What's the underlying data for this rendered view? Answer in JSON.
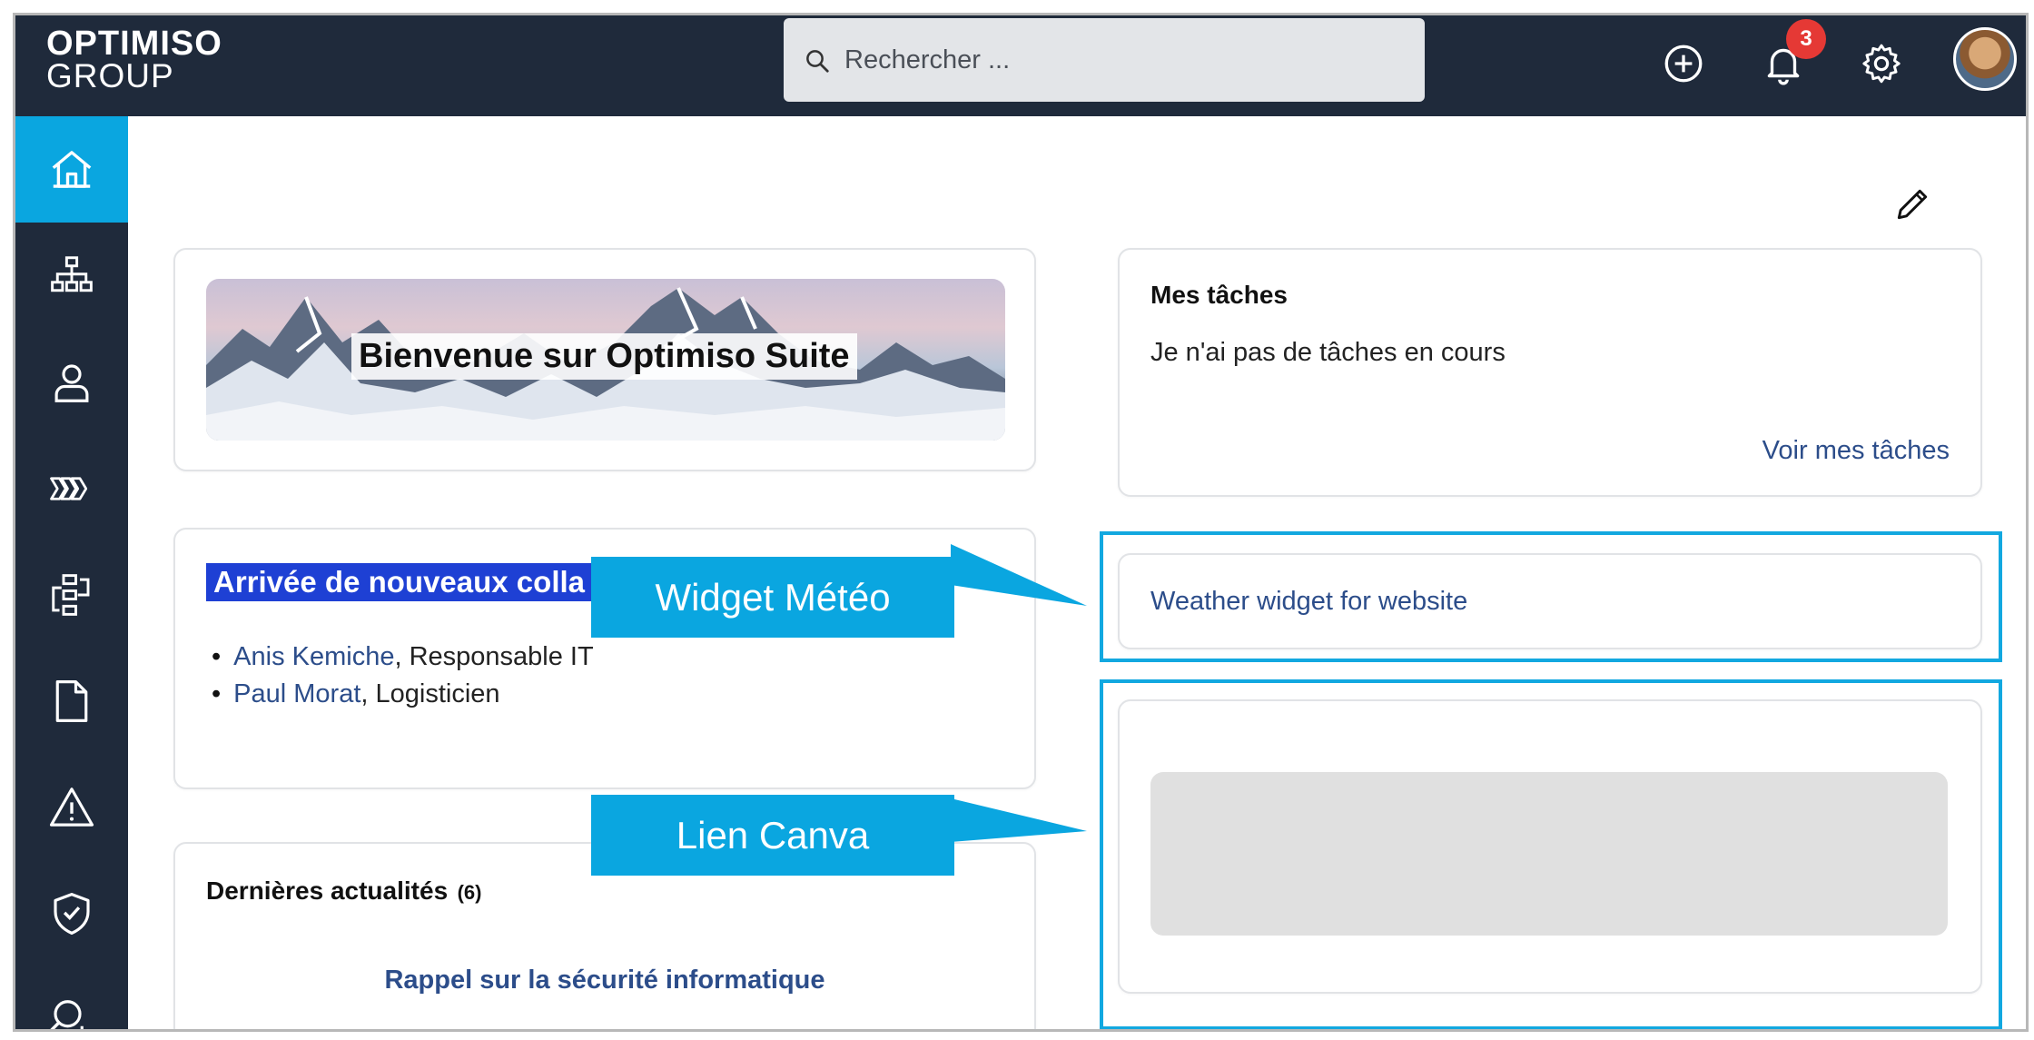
{
  "header": {
    "logo_line1": "OPTIMISO",
    "logo_line2": "GROUP",
    "search_placeholder": "Rechercher ...",
    "notification_count": "3",
    "icons": [
      "search-icon",
      "add-circle-icon",
      "bell-icon",
      "gear-icon",
      "avatar"
    ]
  },
  "sidebar": {
    "items": [
      {
        "icon": "home-icon",
        "active": true
      },
      {
        "icon": "org-chart-icon"
      },
      {
        "icon": "user-icon"
      },
      {
        "icon": "process-chevrons-icon"
      },
      {
        "icon": "workflow-icon"
      },
      {
        "icon": "document-icon"
      },
      {
        "icon": "warning-icon"
      },
      {
        "icon": "shield-check-icon"
      },
      {
        "icon": "search-analytics-icon"
      }
    ]
  },
  "welcome_card": {
    "banner_title": "Bienvenue sur Optimiso Suite"
  },
  "newcomers_card": {
    "title": "Arrivée de nouveaux colla",
    "people": [
      {
        "name": "Anis Kemiche",
        "role": ", Responsable IT"
      },
      {
        "name": "Paul Morat",
        "role": ", Logisticien"
      }
    ]
  },
  "news_card": {
    "title": "Dernières actualités",
    "count": "(6)",
    "item": "Rappel sur la sécurité informatique"
  },
  "tasks_card": {
    "title": "Mes tâches",
    "empty_text": "Je n'ai pas de tâches en cours",
    "link": "Voir mes tâches"
  },
  "weather_card": {
    "link": "Weather widget for website"
  },
  "annotations": {
    "weather_label": "Widget Météo",
    "canva_label": "Lien Canva",
    "color": "#0aa6e0"
  },
  "colors": {
    "topbar": "#1f2a3b",
    "accent": "#0aa6e0",
    "badge": "#e53935",
    "link": "#2c4d8a"
  }
}
